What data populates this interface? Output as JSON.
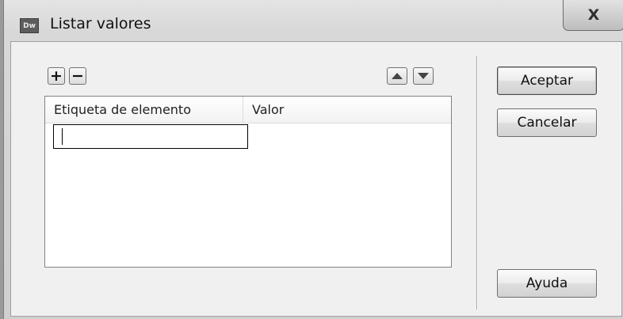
{
  "window": {
    "app_icon_text": "Dw",
    "title": "Listar valores",
    "close_glyph": "X"
  },
  "toolbar": {
    "add_glyph": "+",
    "remove_glyph": "−",
    "move_up_icon": "triangle-up-icon",
    "move_down_icon": "triangle-down-icon"
  },
  "list": {
    "columns": [
      "Etiqueta de elemento",
      "Valor"
    ],
    "rows": [
      {
        "label": "",
        "value": ""
      }
    ]
  },
  "buttons": {
    "ok": "Aceptar",
    "cancel": "Cancelar",
    "help": "Ayuda"
  }
}
